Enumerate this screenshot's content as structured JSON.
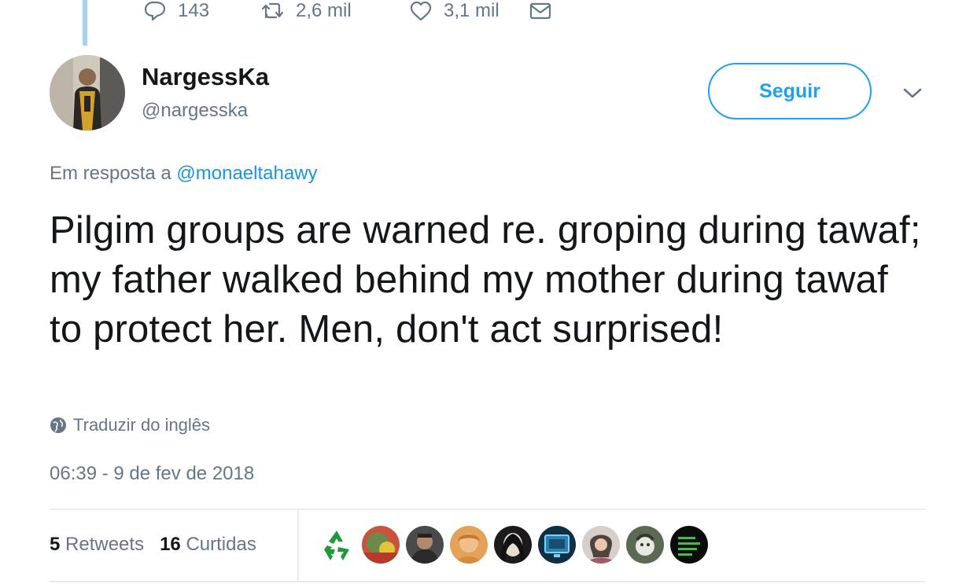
{
  "previous_tweet": {
    "actions": [
      {
        "icon": "reply-icon",
        "count": "143"
      },
      {
        "icon": "retweet-icon",
        "count": "2,6 mil"
      },
      {
        "icon": "like-icon",
        "count": "3,1 mil"
      },
      {
        "icon": "message-icon",
        "count": ""
      }
    ]
  },
  "author": {
    "display_name": "NargessKa",
    "handle": "@nargesska",
    "avatar_icon": "user-avatar"
  },
  "follow_button": {
    "label": "Seguir"
  },
  "reply_context": {
    "prefix": "Em resposta a",
    "mention": "@monaeltahawy"
  },
  "tweet": {
    "text": "Pilgim groups are warned re. groping during tawaf; my father walked behind my mother during tawaf to protect her. Men, don't act surprised!",
    "translate_label": "Traduzir do inglês",
    "timestamp": "06:39 - 9 de fev de 2018"
  },
  "stats": {
    "retweets_count": "5",
    "retweets_label": "Retweets",
    "likes_count": "16",
    "likes_label": "Curtidas"
  },
  "likers": [
    "recycle-avatar",
    "liker-avatar-2",
    "liker-avatar-3",
    "liker-avatar-4",
    "liker-avatar-5",
    "liker-avatar-6",
    "liker-avatar-7",
    "liker-avatar-8",
    "liker-avatar-9"
  ],
  "colors": {
    "accent": "#1da1f2",
    "mention": "#1b95e0",
    "secondary_text": "#657786",
    "primary_text": "#14171a",
    "divider": "#e6ecf0",
    "thread_line": "#a6d2f2"
  }
}
